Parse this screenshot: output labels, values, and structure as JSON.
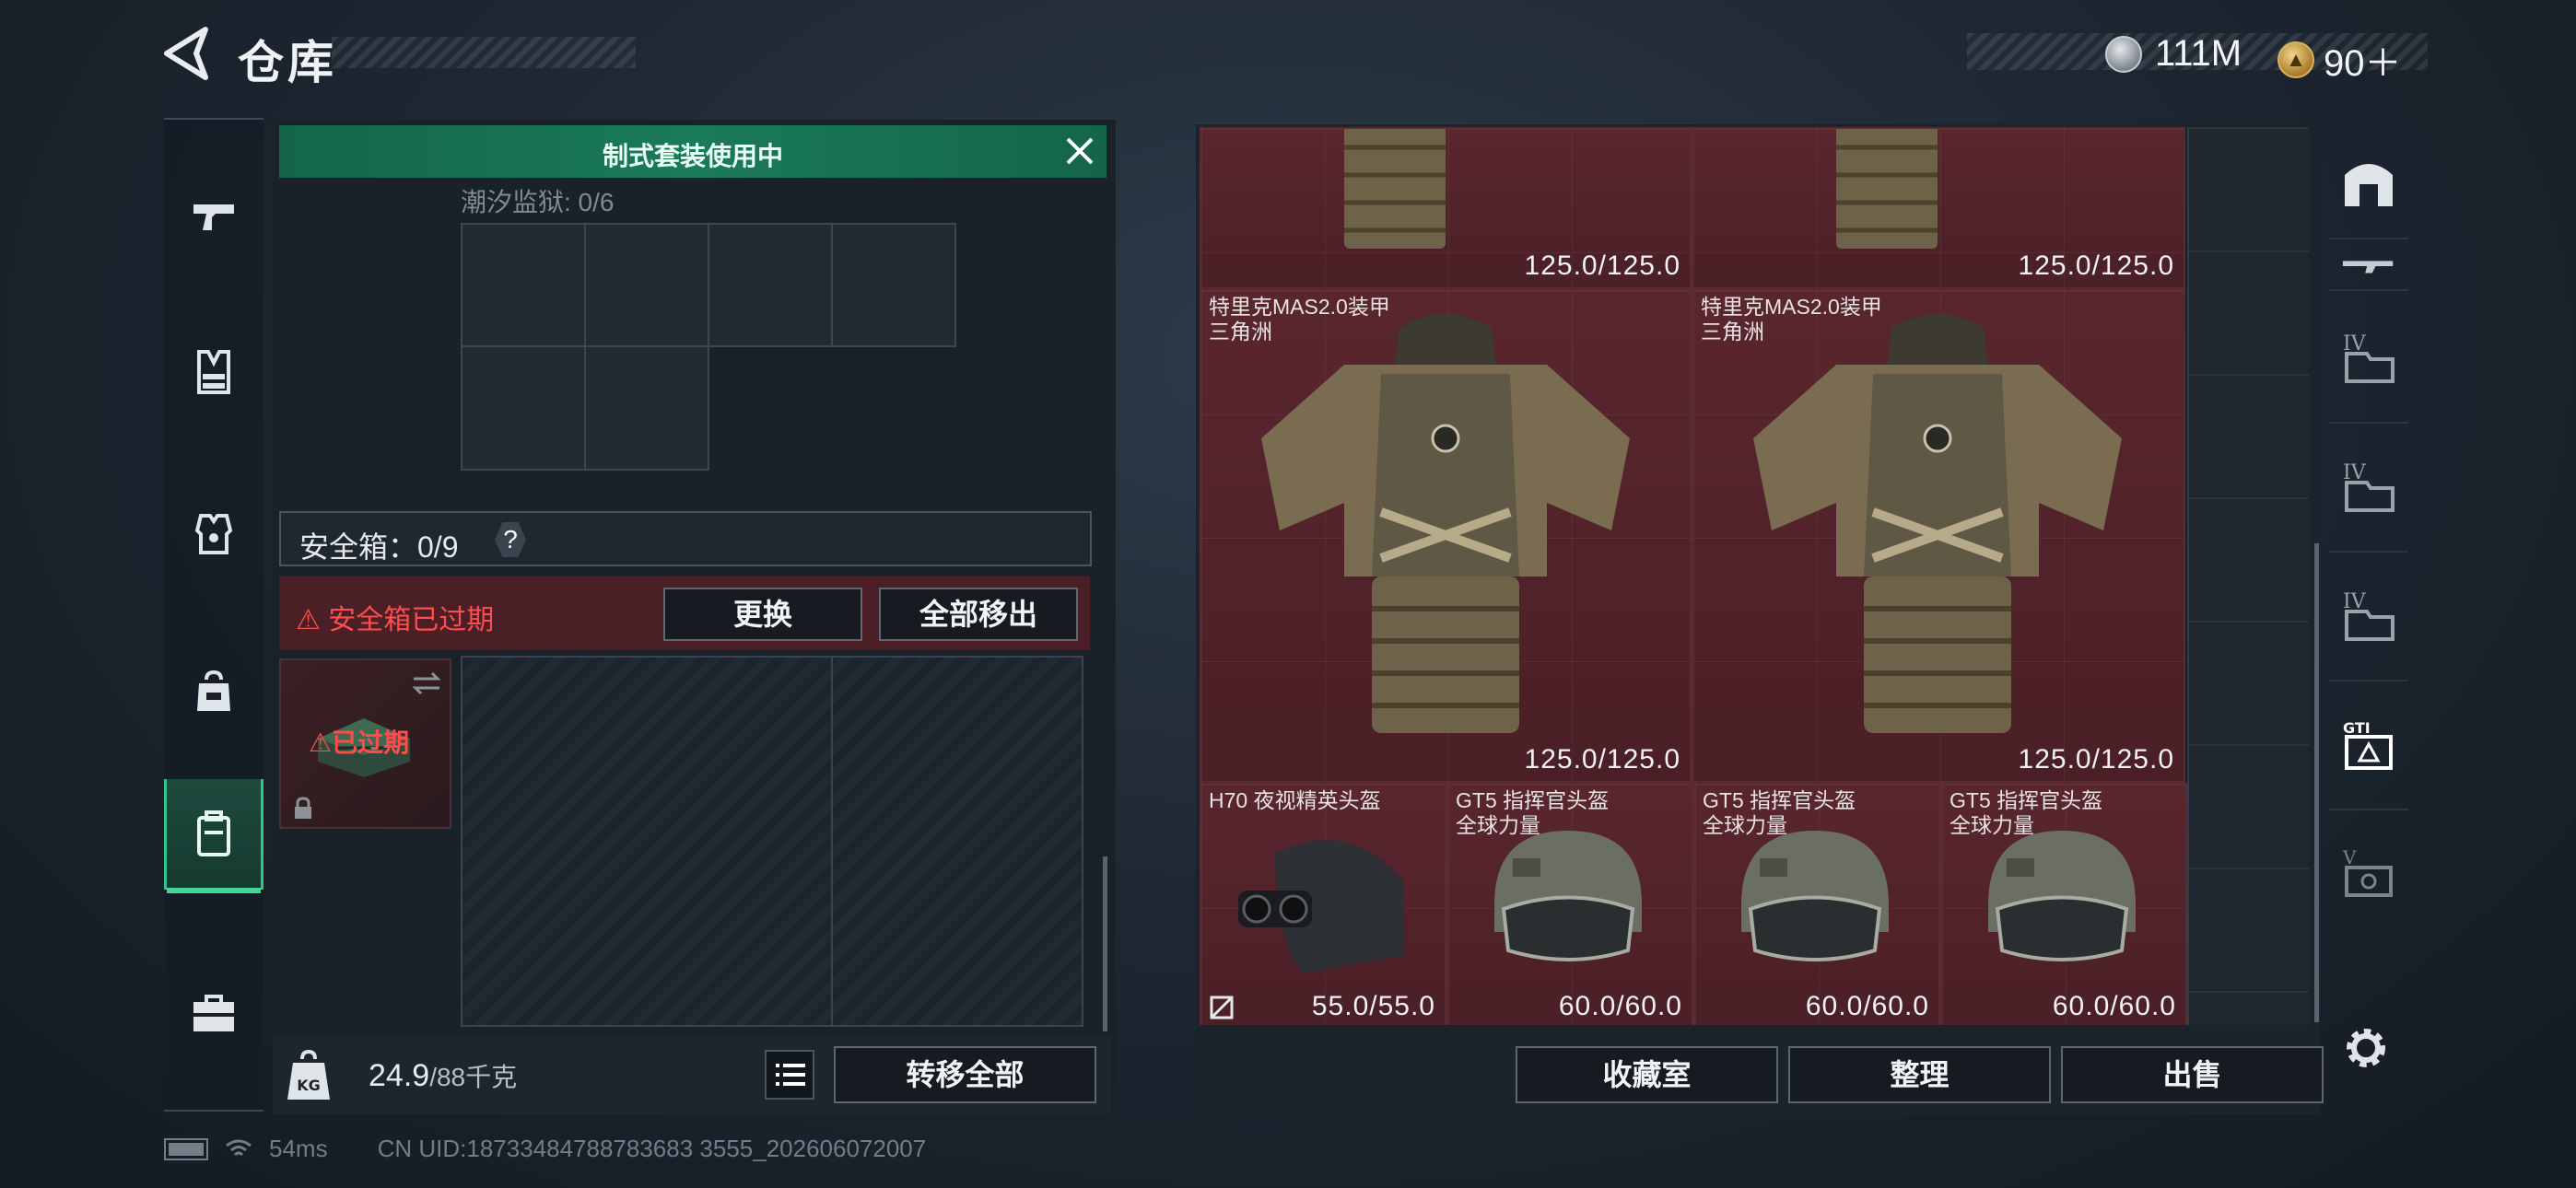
{
  "header": {
    "title": "仓库",
    "currency": [
      {
        "icon": "silver-coin-icon",
        "value": "111M"
      },
      {
        "icon": "gold-triangle-coin-icon",
        "value": "90＋"
      }
    ]
  },
  "left_nav": {
    "items": [
      {
        "name": "pistol-icon"
      },
      {
        "name": "chest-rig-icon"
      },
      {
        "name": "armor-vest-icon"
      },
      {
        "name": "backpack-icon"
      },
      {
        "name": "safe-case-icon",
        "active": true
      },
      {
        "name": "toolbox-icon"
      }
    ]
  },
  "loadout": {
    "banner": "制式套装使用中",
    "grid_label": "潮汐监狱: 0/6",
    "safe_box_label": "安全箱：0/9",
    "safe_help": "?",
    "expired_warning": "安全箱已过期",
    "replace_button": "更换",
    "remove_all_button": "全部移出",
    "case_expired_label": "已过期",
    "weight_current": "24.9",
    "weight_max": "/88千克",
    "transfer_all_button": "转移全部"
  },
  "stash": {
    "items": [
      {
        "name": "",
        "sub": "",
        "durability": "125.0/125.0"
      },
      {
        "name": "",
        "sub": "",
        "durability": "125.0/125.0"
      },
      {
        "name": "特里克MAS2.0装甲",
        "sub": "三角洲",
        "durability": "125.0/125.0"
      },
      {
        "name": "特里克MAS2.0装甲",
        "sub": "三角洲",
        "durability": "125.0/125.0"
      },
      {
        "name": "H70 夜视精英头盔",
        "sub": "",
        "durability": "55.0/55.0"
      },
      {
        "name": "GT5 指挥官头盔",
        "sub": "全球力量",
        "durability": "60.0/60.0"
      },
      {
        "name": "GT5 指挥官头盔",
        "sub": "全球力量",
        "durability": "60.0/60.0"
      },
      {
        "name": "GT5 指挥官头盔",
        "sub": "全球力量",
        "durability": "60.0/60.0"
      }
    ],
    "collection_button": "收藏室",
    "sort_button": "整理",
    "sell_button": "出售"
  },
  "right_nav": {
    "items": [
      {
        "name": "safe-house-icon"
      },
      {
        "name": "rifle-icon"
      },
      {
        "name": "tier4-folder-icon",
        "label": "IV"
      },
      {
        "name": "tier4-folder-icon",
        "label": "IV"
      },
      {
        "name": "tier4-folder-icon",
        "label": "IV"
      },
      {
        "name": "gti-container-icon",
        "label": "GTI",
        "active": true
      },
      {
        "name": "tier5-container-icon",
        "label": "V"
      }
    ]
  },
  "footer": {
    "ping": "54ms",
    "uid": "CN UID:18733484788783683 3555_202606072007"
  },
  "colors": {
    "accent_green": "#1a7a5a",
    "expired_red": "#ff4c4c",
    "item_bg": "#4a1f26"
  }
}
